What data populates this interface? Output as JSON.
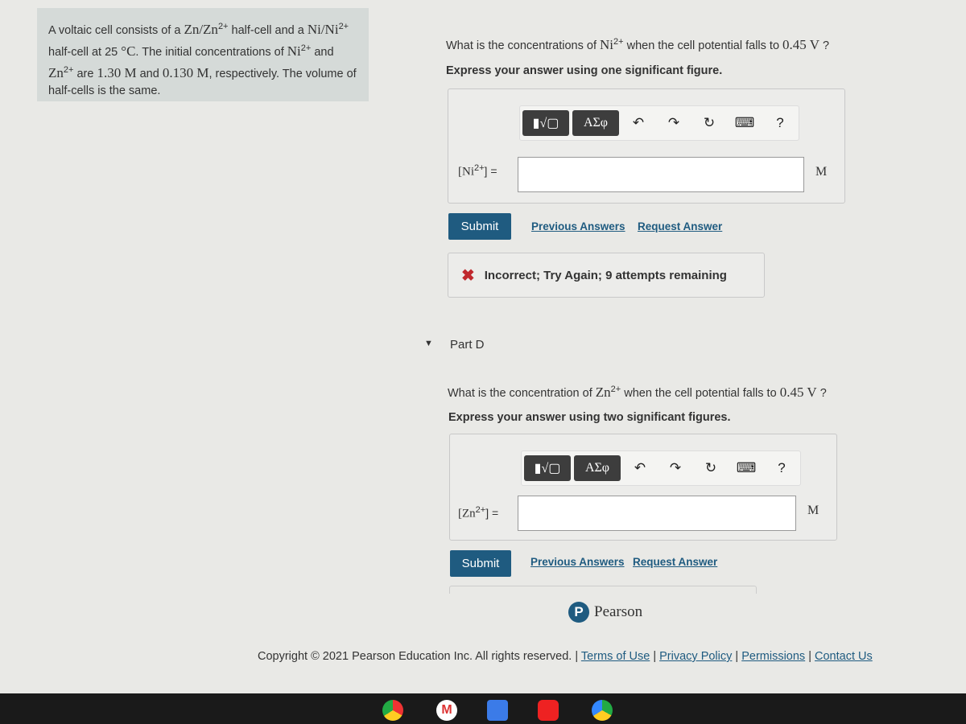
{
  "problem": {
    "t1": "A voltaic cell consists of a ",
    "zn_couple": "Zn/Zn",
    "sup": "2+",
    "t2": " half-cell and a ",
    "ni_couple": "Ni/Ni",
    "t3": " half-cell at 25 ",
    "deg": "°C",
    "t4": ". The initial concentrations of ",
    "ni": "Ni",
    "t5": " and ",
    "zn": "Zn",
    "t6": " are ",
    "c1": "1.30 M",
    "t7": " and ",
    "c2": "0.130 M",
    "t8": ", respectively. The volume of half-cells is the same."
  },
  "part_c": {
    "q1": "What is the concentrations of ",
    "ion": "Ni",
    "sup": "2+",
    "q2": " when the cell potential falls to ",
    "v": "0.45 V",
    "q3": " ?",
    "instruction": "Express your answer using one significant figure.",
    "label_pre": "[Ni",
    "label_post": "] =",
    "input_value": "",
    "unit": "M",
    "submit": "Submit",
    "previous_answers": "Previous Answers",
    "request_answer": "Request Answer",
    "feedback": "Incorrect; Try Again; 9 attempts remaining"
  },
  "toolbar": {
    "templates_icon": "fraction-root-icon",
    "greek": "ΑΣφ",
    "undo_icon": "undo-icon",
    "redo_icon": "redo-icon",
    "reset_icon": "reset-icon",
    "keyboard_icon": "keyboard-icon",
    "help": "?"
  },
  "part_d": {
    "title": "Part D",
    "q1": "What is the concentration of ",
    "ion": "Zn",
    "sup": "2+",
    "q2": " when the cell potential falls to ",
    "v": "0.45 V",
    "q3": " ?",
    "instruction": "Express your answer using two significant figures.",
    "label_pre": "[Zn",
    "label_post": "] =",
    "input_value": "",
    "unit": "M",
    "submit": "Submit",
    "previous_answers": "Previous Answers",
    "request_answer": "Request Answer"
  },
  "footer": {
    "brand": "Pearson",
    "copyright": "Copyright © 2021 Pearson Education Inc. All rights reserved.",
    "terms": "Terms of Use",
    "privacy": "Privacy Policy",
    "permissions": "Permissions",
    "contact": "Contact Us"
  },
  "colors": {
    "accent": "#1f5b80",
    "error": "#c0282d",
    "problem_bg": "#d5dad8"
  }
}
